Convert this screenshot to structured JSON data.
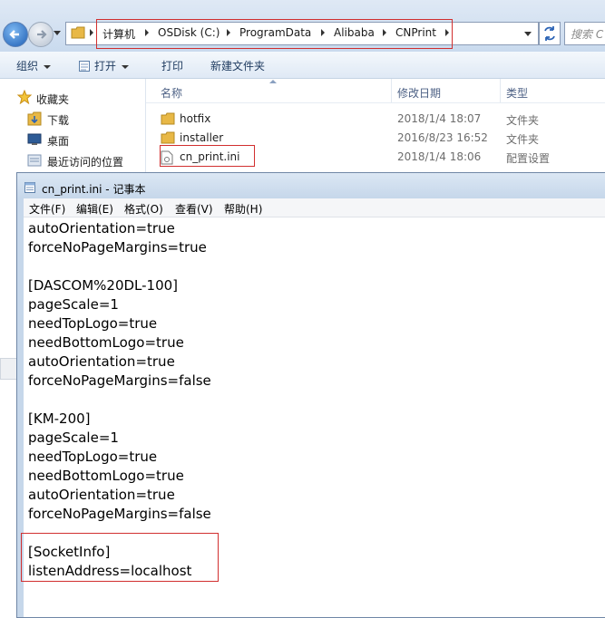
{
  "explorer": {
    "breadcrumbs": [
      "计算机",
      "OSDisk (C:)",
      "ProgramData",
      "Alibaba",
      "CNPrint"
    ],
    "search_placeholder": "搜索 C",
    "toolbar": {
      "organize": "组织",
      "open": "打开",
      "print": "打印",
      "new_folder": "新建文件夹"
    },
    "nav_pane": {
      "favorites": "收藏夹",
      "downloads": "下载",
      "desktop": "桌面",
      "recent": "最近访问的位置"
    },
    "columns": {
      "name": "名称",
      "modified": "修改日期",
      "type": "类型"
    },
    "files": [
      {
        "name": "hotfix",
        "date": "2018/1/4 18:07",
        "type": "文件夹",
        "icon": "folder-icon"
      },
      {
        "name": "installer",
        "date": "2016/8/23 16:52",
        "type": "文件夹",
        "icon": "folder-icon"
      },
      {
        "name": "cn_print.ini",
        "date": "2018/1/4 18:06",
        "type": "配置设置",
        "icon": "ini-file-icon"
      }
    ]
  },
  "notepad": {
    "title": "cn_print.ini - 记事本",
    "menu": [
      "文件(F)",
      "编辑(E)",
      "格式(O)",
      "查看(V)",
      "帮助(H)"
    ],
    "lines": [
      "autoOrientation=true",
      "forceNoPageMargins=true",
      "",
      "[DASCOM%20DL-100]",
      "pageScale=1",
      "needTopLogo=true",
      "needBottomLogo=true",
      "autoOrientation=true",
      "forceNoPageMargins=false",
      "",
      "[KM-200]",
      "pageScale=1",
      "needTopLogo=true",
      "needBottomLogo=true",
      "autoOrientation=true",
      "forceNoPageMargins=false",
      "",
      "[SocketInfo]",
      "listenAddress=localhost"
    ]
  },
  "colors": {
    "highlight_box": "#d12f2f",
    "window_frame": "#c6d7ea",
    "folder": "#e8b846"
  }
}
